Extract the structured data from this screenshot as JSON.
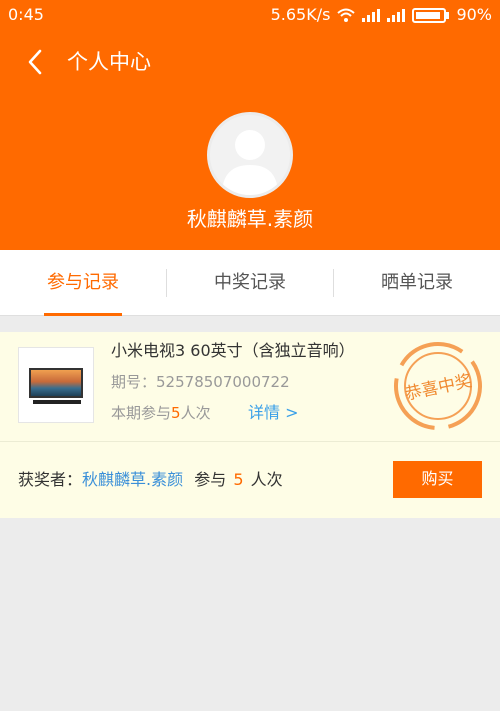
{
  "status_bar": {
    "time": "0:45",
    "speed": "5.65K/s",
    "battery": "90%"
  },
  "header": {
    "title": "个人中心",
    "username": "秋麒麟草.素颜"
  },
  "tabs": [
    {
      "label": "参与记录",
      "active": true
    },
    {
      "label": "中奖记录",
      "active": false
    },
    {
      "label": "晒单记录",
      "active": false
    }
  ],
  "record": {
    "product_title": "小米电视3 60英寸（含独立音响）",
    "period_label": "期号：",
    "period": "52578507000722",
    "participate_prefix": "本期参与",
    "participate_count": "5",
    "participate_suffix": "人次",
    "details_label": "详情 >",
    "stamp_text": "恭喜中奖",
    "winner_label": "获奖者：",
    "winner_name": "秋麒麟草.素颜",
    "winner_join_prefix": "参与",
    "winner_join_count": "5",
    "winner_join_suffix": "人次",
    "buy_label": "购买"
  },
  "colors": {
    "brand": "#ff6a00",
    "link": "#3aa0e8",
    "card_bg": "#fefde6"
  }
}
